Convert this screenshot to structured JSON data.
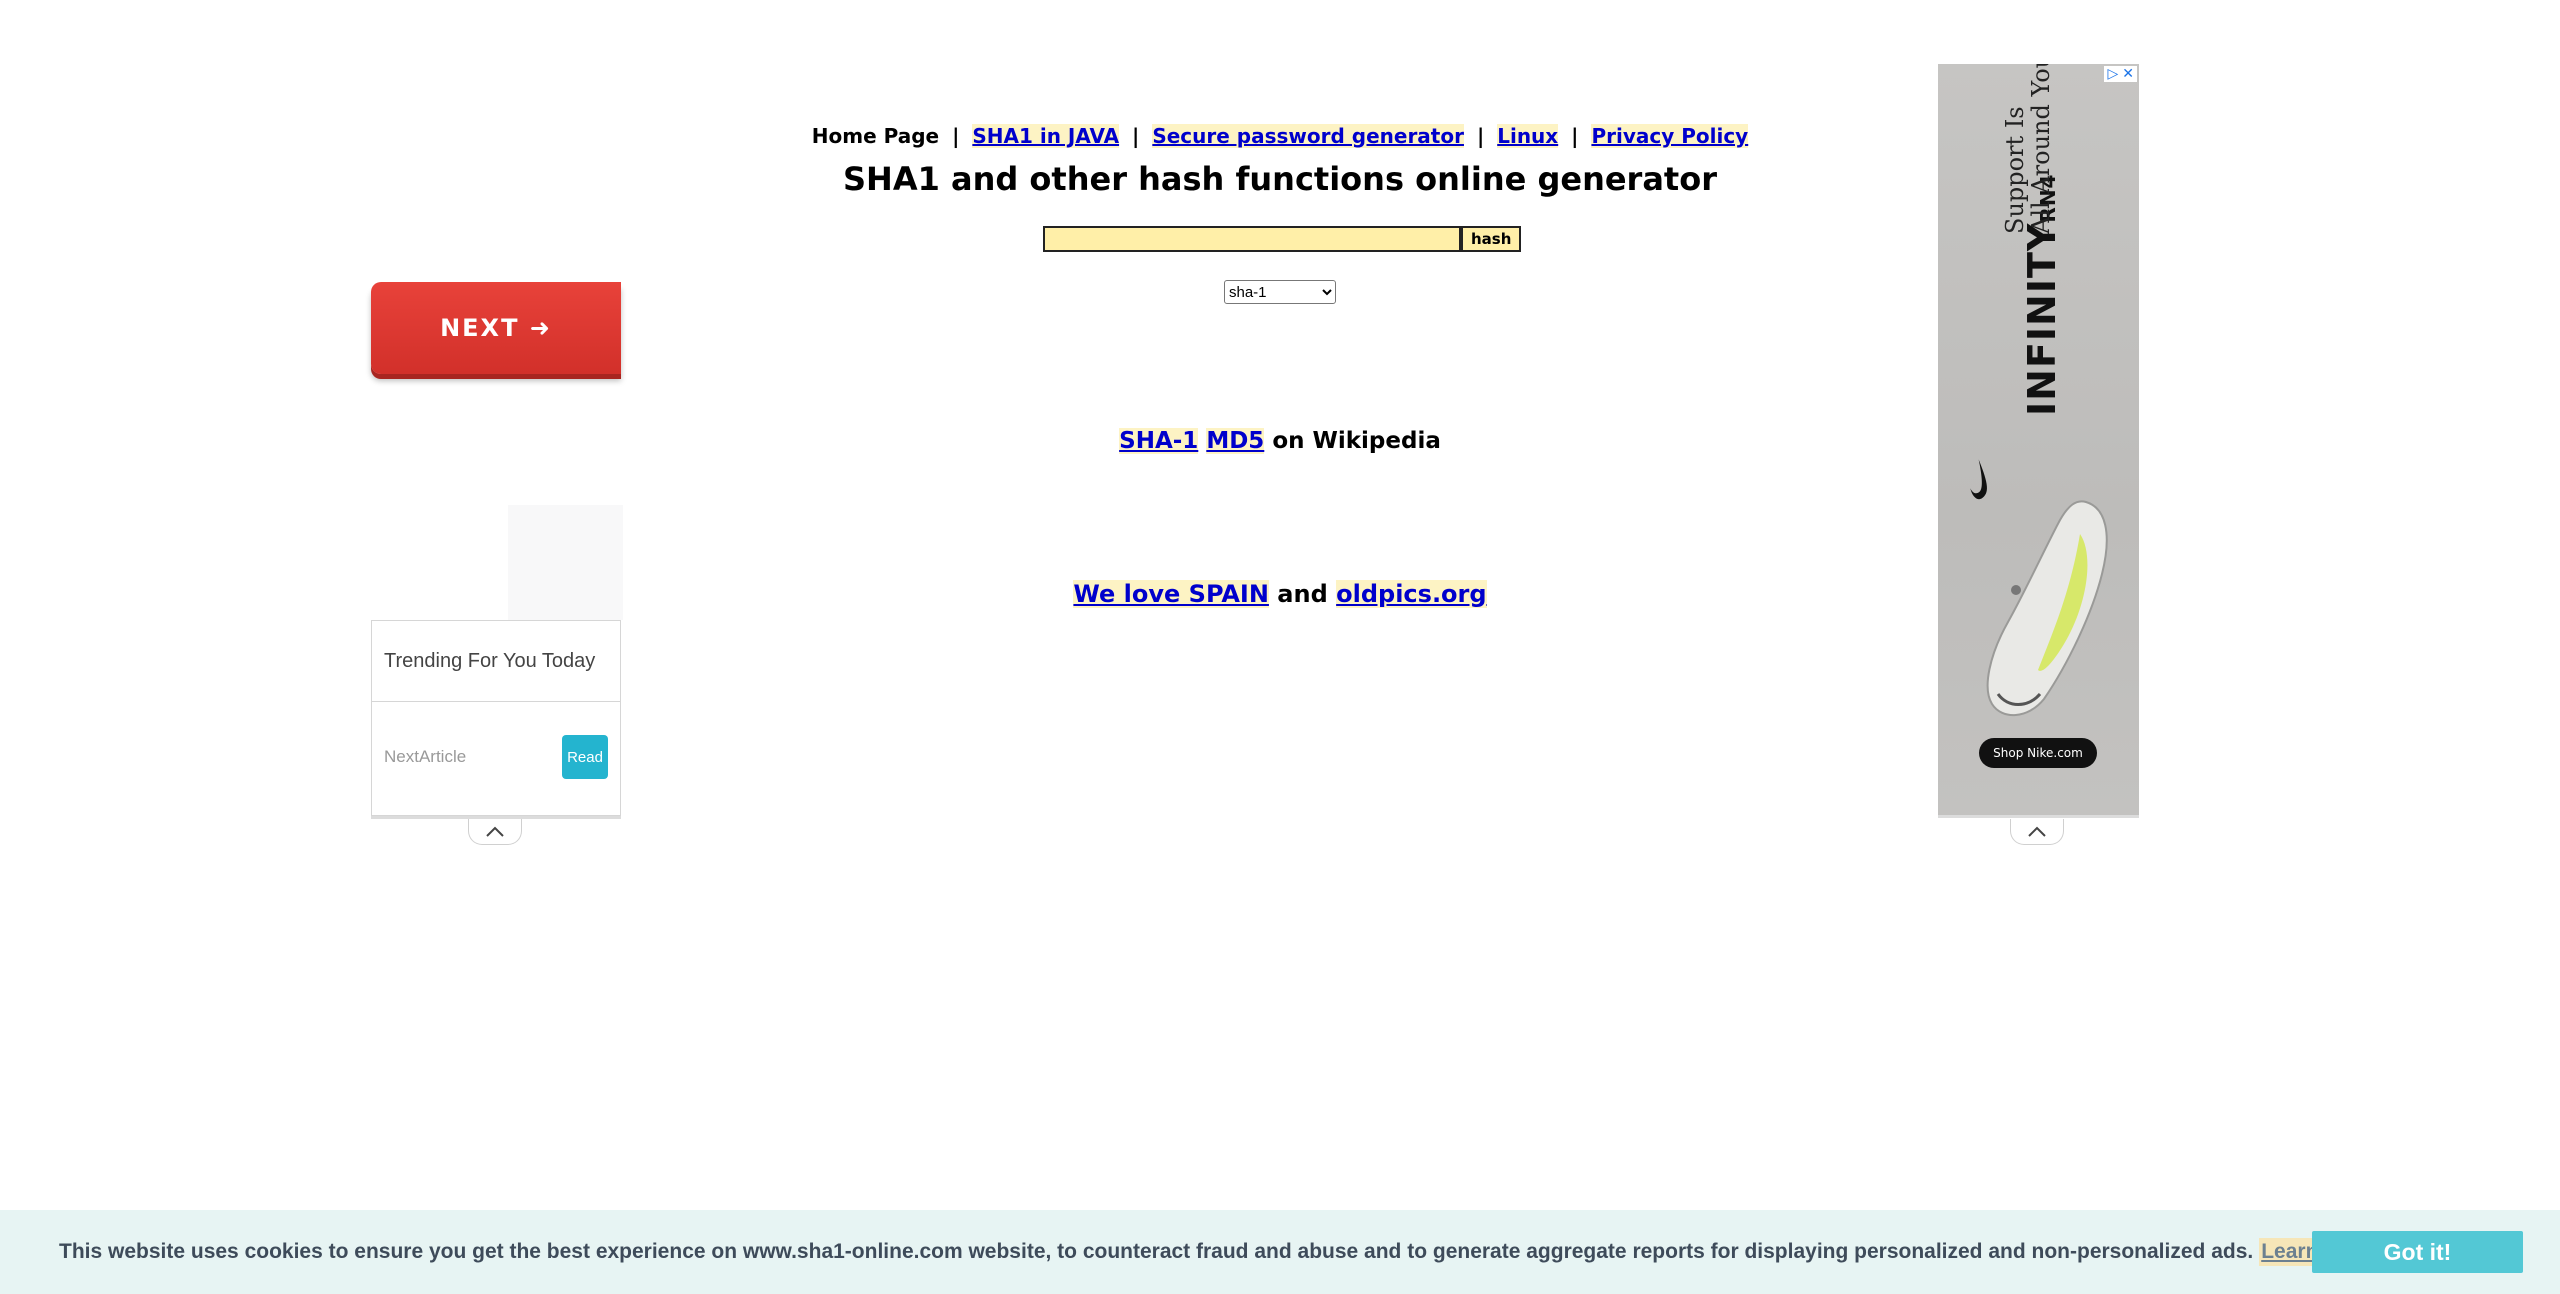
{
  "nav": {
    "home": "Home Page",
    "sep": "|",
    "links": [
      "SHA1 in JAVA",
      "Secure password generator",
      "Linux",
      "Privacy Policy"
    ]
  },
  "page_title": "SHA1 and other hash functions online generator",
  "form": {
    "input_value": "",
    "hash_button": "hash",
    "algorithm_selected": "sha-1"
  },
  "wiki": {
    "link1": "SHA-1",
    "link2": "MD5",
    "suffix": "on Wikipedia"
  },
  "promo": {
    "link1": "We love SPAIN",
    "connector": "and",
    "link2": "oldpics.org"
  },
  "left_ad": {
    "next_button": "NEXT ➜",
    "trending_title": "Trending For You Today",
    "next_article": "NextArticle",
    "read_button": "Read"
  },
  "right_ad": {
    "brand": "INFINITY",
    "brand_suffix": "RN4",
    "tagline_line1": "Support Is",
    "tagline_line2": "All Around You",
    "shop_button": "Shop Nike.com",
    "adchoices_icon": "▷",
    "close_icon": "✕"
  },
  "cookie": {
    "text": "This website uses cookies to ensure you get the best experience on www.sha1-online.com website, to counteract fraud and abuse and to generate aggregate reports for displaying personalized and non-personalized ads.",
    "learn_more": "Learn more",
    "got_it": "Got it!"
  },
  "icons": {
    "collapse": "chevron-up-icon"
  }
}
